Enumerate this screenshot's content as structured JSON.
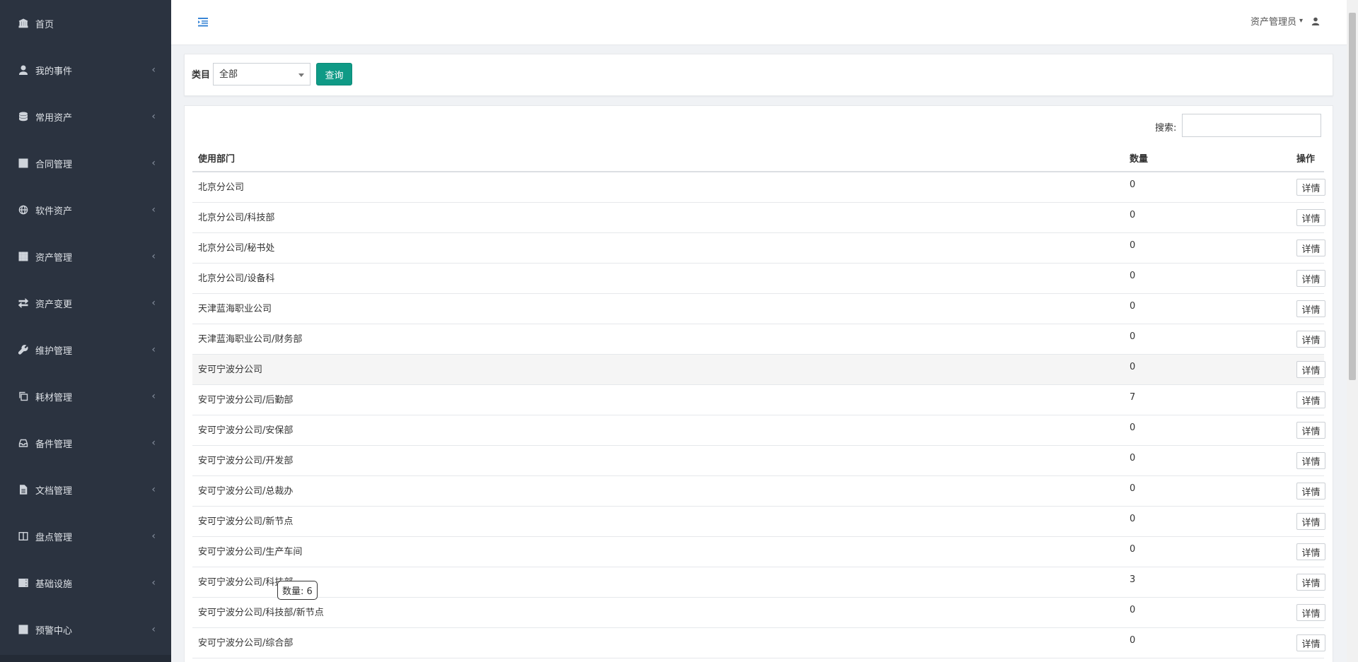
{
  "sidebar": {
    "items": [
      {
        "label": "首页",
        "icon": "bank-icon",
        "has_chevron": false
      },
      {
        "label": "我的事件",
        "icon": "user-icon",
        "has_chevron": true
      },
      {
        "label": "常用资产",
        "icon": "database-icon",
        "has_chevron": true
      },
      {
        "label": "合同管理",
        "icon": "grid-icon",
        "has_chevron": true
      },
      {
        "label": "软件资产",
        "icon": "globe-icon",
        "has_chevron": true
      },
      {
        "label": "资产管理",
        "icon": "apps-icon",
        "has_chevron": true
      },
      {
        "label": "资产变更",
        "icon": "exchange-icon",
        "has_chevron": true
      },
      {
        "label": "维护管理",
        "icon": "wrench-icon",
        "has_chevron": true
      },
      {
        "label": "耗材管理",
        "icon": "copy-icon",
        "has_chevron": true
      },
      {
        "label": "备件管理",
        "icon": "inbox-icon",
        "has_chevron": true
      },
      {
        "label": "文档管理",
        "icon": "file-icon",
        "has_chevron": true
      },
      {
        "label": "盘点管理",
        "icon": "columns-icon",
        "has_chevron": true
      },
      {
        "label": "基础设施",
        "icon": "server-icon",
        "has_chevron": true
      },
      {
        "label": "预警中心",
        "icon": "grid-icon",
        "has_chevron": true
      }
    ],
    "chevron_glyph": "‹"
  },
  "header": {
    "user_name": "资产管理员",
    "caret": "▾"
  },
  "filter": {
    "label": "类目",
    "select_value": "全部",
    "query_label": "查询"
  },
  "table": {
    "search_label": "搜索:",
    "search_value": "",
    "columns": [
      "使用部门",
      "数量",
      "操作"
    ],
    "detail_label": "详情",
    "rows": [
      {
        "dept": "北京分公司",
        "qty": "0"
      },
      {
        "dept": "北京分公司/科技部",
        "qty": "0"
      },
      {
        "dept": "北京分公司/秘书处",
        "qty": "0"
      },
      {
        "dept": "北京分公司/设备科",
        "qty": "0"
      },
      {
        "dept": "天津蓝海职业公司",
        "qty": "0"
      },
      {
        "dept": "天津蓝海职业公司/财务部",
        "qty": "0"
      },
      {
        "dept": "安可宁波分公司",
        "qty": "0"
      },
      {
        "dept": "安可宁波分公司/后勤部",
        "qty": "7"
      },
      {
        "dept": "安可宁波分公司/安保部",
        "qty": "0"
      },
      {
        "dept": "安可宁波分公司/开发部",
        "qty": "0"
      },
      {
        "dept": "安可宁波分公司/总裁办",
        "qty": "0"
      },
      {
        "dept": "安可宁波分公司/新节点",
        "qty": "0"
      },
      {
        "dept": "安可宁波分公司/生产车间",
        "qty": "0"
      },
      {
        "dept": "安可宁波分公司/科技部",
        "qty": "3"
      },
      {
        "dept": "安可宁波分公司/科技部/新节点",
        "qty": "0"
      },
      {
        "dept": "安可宁波分公司/综合部",
        "qty": "0"
      }
    ],
    "hover_row_index": 6
  },
  "tooltip": {
    "text": "数量: 6"
  },
  "colors": {
    "sidebar_bg": "#2b3340",
    "accent": "#0f9a86",
    "toggle_icon": "#3a86d6"
  }
}
